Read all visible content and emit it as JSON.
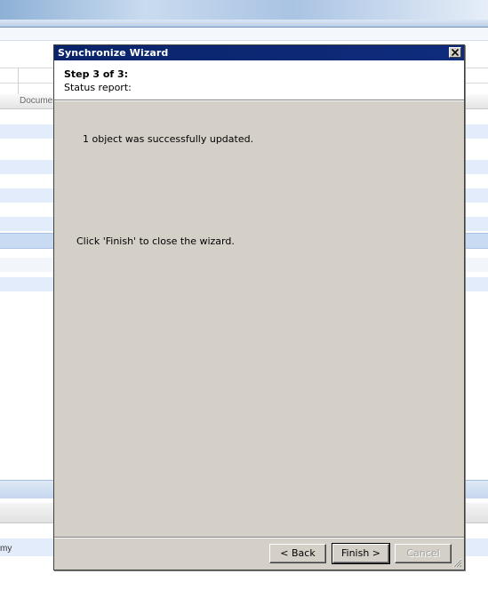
{
  "background": {
    "column_header": "Documen",
    "left_fragment": "my"
  },
  "dialog": {
    "title": "Synchronize Wizard",
    "step": "Step 3 of 3:",
    "subtitle": "Status report:",
    "result": "1 object was successfully updated.",
    "finish_hint": "Click 'Finish' to close the wizard.",
    "buttons": {
      "back": "< Back",
      "finish": "Finish >",
      "cancel": "Cancel"
    }
  },
  "colors": {
    "titlebar": "#0a246a",
    "dialog_face": "#d4d0c8",
    "header_panel": "#ffffff",
    "bg_row_blue": "#e3ecfa",
    "bg_selected_row": "#c9daf3"
  }
}
